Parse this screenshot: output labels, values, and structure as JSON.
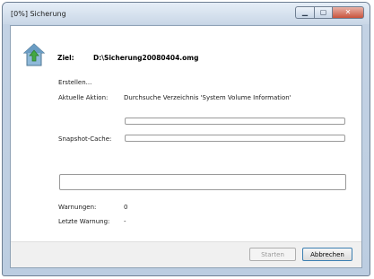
{
  "window": {
    "title": "[0%] Sicherung"
  },
  "caption": {
    "minimize": "▁",
    "maximize": "▢",
    "close": "✕"
  },
  "header": {
    "ziel_label": "Ziel:",
    "ziel_value": "D:\\Sicherung20080404.omg",
    "icon": "backup-house-icon"
  },
  "status": {
    "state_text": "Erstellen...",
    "action_label": "Aktuelle Aktion:",
    "action_value": "Durchsuche Verzeichnis 'System Volume Information'",
    "progress_percent": 0,
    "snapshot_label": "Snapshot-Cache:",
    "snapshot_percent": 0
  },
  "warnings": {
    "count_label": "Warnungen:",
    "count_value": "0",
    "last_label": "Letzte Warnung:",
    "last_value": "-"
  },
  "buttons": {
    "start": "Starten",
    "cancel": "Abbrechen"
  },
  "colors": {
    "progress": "#3eb23e",
    "titlebar": "#c9d7e7",
    "close_button": "#c8533d"
  }
}
